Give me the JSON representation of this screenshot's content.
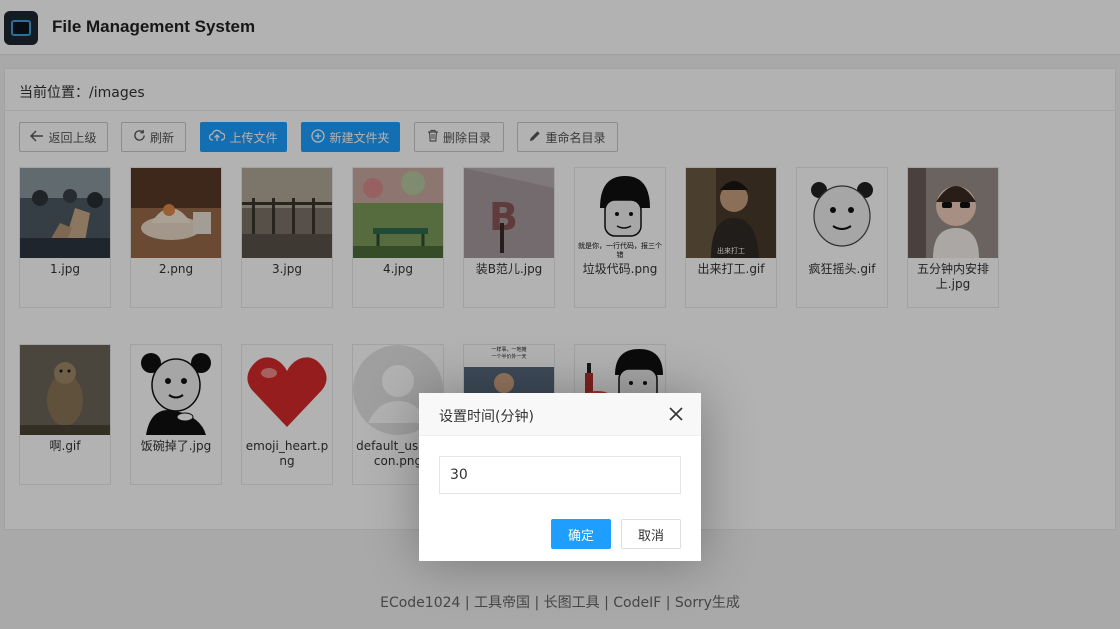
{
  "app": {
    "title": "File Management System"
  },
  "location": {
    "label": "当前位置：",
    "path": "/images"
  },
  "toolbar": {
    "back": {
      "label": "返回上级",
      "icon": "arrow-left-icon"
    },
    "refresh": {
      "label": "刷新",
      "icon": "refresh-icon"
    },
    "upload": {
      "label": "上传文件",
      "icon": "cloud-upload-icon"
    },
    "new_folder": {
      "label": "新建文件夹",
      "icon": "plus-circle-icon"
    },
    "delete_dir": {
      "label": "删除目录",
      "icon": "trash-icon"
    },
    "rename_dir": {
      "label": "重命名目录",
      "icon": "pencil-icon"
    }
  },
  "files": [
    {
      "name": "1.jpg"
    },
    {
      "name": "2.png"
    },
    {
      "name": "3.jpg"
    },
    {
      "name": "4.jpg"
    },
    {
      "name": "装B范儿.jpg"
    },
    {
      "name": "垃圾代码.png"
    },
    {
      "name": "出来打工.gif"
    },
    {
      "name": "疯狂摇头.gif"
    },
    {
      "name": "五分钟内安排上.jpg"
    },
    {
      "name": "啊.gif"
    },
    {
      "name": "饭碗掉了.jpg"
    },
    {
      "name": "emoji_heart.png"
    },
    {
      "name": "default_user_icon.png"
    },
    {
      "name": ""
    },
    {
      "name": ""
    }
  ],
  "thumb_text": {
    "garbage_code": "就是你，一行代码，报三个错",
    "news_caption": "一样事，一地摊\n一个半价外一天",
    "work_caption": "出来打工"
  },
  "dialog": {
    "title": "设置时间(分钟)",
    "close_icon": "close-icon",
    "input_value": "30",
    "ok_label": "确定",
    "cancel_label": "取消"
  },
  "footer": {
    "text": "ECode1024 | 工具帝国 | 长图工具 | CodeIF | Sorry生成"
  },
  "colors": {
    "primary": "#1e9fff",
    "overlay": "rgba(0,0,0,0.3)"
  }
}
